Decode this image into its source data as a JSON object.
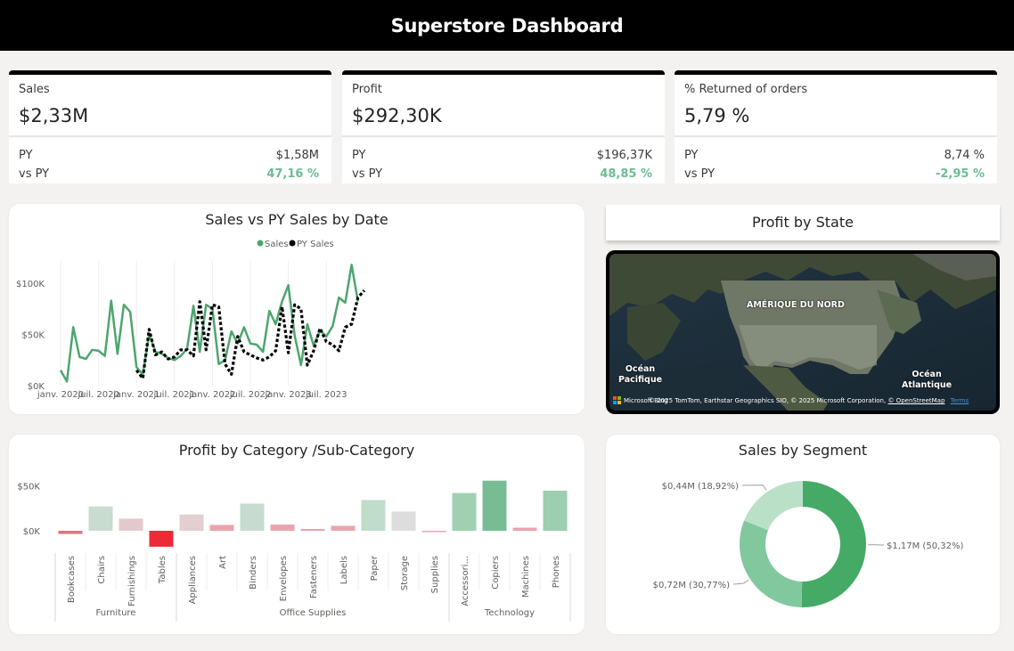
{
  "header": {
    "title": "Superstore Dashboard"
  },
  "kpis": [
    {
      "label": "Sales",
      "value": "$2,33M",
      "py_label": "PY",
      "py_value": "$1,58M",
      "vs_label": "vs PY",
      "vs_value": "47,16 %",
      "vs_color": "#6cbd91"
    },
    {
      "label": "Profit",
      "value": "$292,30K",
      "py_label": "PY",
      "py_value": "$196,37K",
      "vs_label": "vs PY",
      "vs_value": "48,85 %",
      "vs_color": "#6cbd91"
    },
    {
      "label": "% Returned of orders",
      "value": "5,79 %",
      "py_label": "PY",
      "py_value": "8,74 %",
      "vs_label": "vs PY",
      "vs_value": "-2,95 %",
      "vs_color": "#6cbd91"
    }
  ],
  "line_card": {
    "title": "Sales vs PY Sales by Date"
  },
  "map_card": {
    "title": "Profit by State",
    "label_continent": "AMÉRIQUE DU NORD",
    "label_pacific": "Océan\nPacifique",
    "label_atlantic": "Océan\nAtlantique",
    "brand": "Microsoft Bing",
    "attribution": "© 2025 TomTom, Earthstar Geographics SIO, © 2025 Microsoft Corporation,",
    "osm_link": "© OpenStreetMap",
    "terms_link": "Terms"
  },
  "bar_card": {
    "title": "Profit by Category /Sub-Category"
  },
  "donut_card": {
    "title": "Sales by Segment"
  },
  "chart_data": [
    {
      "type": "line",
      "title": "Sales vs PY Sales by Date",
      "x_ticks": [
        "janv. 2020",
        "juil. 2020",
        "janv. 2021",
        "juil. 2021",
        "janv. 2022",
        "juil. 2022",
        "janv. 2023",
        "juil. 2023"
      ],
      "y_ticks": [
        "$0K",
        "$50K",
        "$100K"
      ],
      "ylim": [
        0,
        120
      ],
      "legend": [
        "Sales",
        "PY Sales"
      ],
      "colors": {
        "Sales": "#4ea56e",
        "PY Sales": "#000000"
      },
      "series": [
        {
          "name": "Sales",
          "start_month": 0,
          "values": [
            15,
            4,
            57,
            28,
            26,
            35,
            34,
            29,
            83,
            31,
            79,
            72,
            18,
            11,
            50,
            33,
            31,
            27,
            25,
            29,
            36,
            78,
            33,
            79,
            75,
            21,
            25,
            53,
            41,
            57,
            41,
            40,
            33,
            73,
            60,
            82,
            98,
            49,
            20,
            60,
            39,
            54,
            48,
            58,
            86,
            81,
            118,
            82
          ]
        },
        {
          "name": "PY Sales",
          "start_month": 12,
          "values": [
            15,
            7,
            55,
            30,
            33,
            26,
            28,
            35,
            35,
            29,
            82,
            35,
            79,
            77,
            21,
            11,
            48,
            33,
            30,
            27,
            25,
            28,
            34,
            77,
            32,
            79,
            75,
            20,
            34,
            56,
            43,
            40,
            34,
            57,
            60,
            86,
            93
          ]
        }
      ]
    },
    {
      "type": "bar",
      "title": "Profit by Category /Sub-Category",
      "y_ticks": [
        "$50K",
        "$0K"
      ],
      "ylim": [
        -18,
        58
      ],
      "groups": [
        {
          "name": "Furniture",
          "items": [
            {
              "label": "Bookcases",
              "value": -3.5,
              "color": "#e8707f"
            },
            {
              "label": "Chairs",
              "value": 27,
              "color": "#c8dcd0"
            },
            {
              "label": "Furnishings",
              "value": 13.5,
              "color": "#e3c9cc"
            },
            {
              "label": "Tables",
              "value": -17.7,
              "color": "#ee2938"
            }
          ]
        },
        {
          "name": "Office Supplies",
          "items": [
            {
              "label": "Appliances",
              "value": 18.1,
              "color": "#e3cfd1"
            },
            {
              "label": "Art",
              "value": 6.5,
              "color": "#e9a4ae"
            },
            {
              "label": "Binders",
              "value": 30.2,
              "color": "#c8dbd0"
            },
            {
              "label": "Envelopes",
              "value": 6.9,
              "color": "#e9a4ae"
            },
            {
              "label": "Fasteners",
              "value": 2.0,
              "color": "#e9a4ae"
            },
            {
              "label": "Labels",
              "value": 5.5,
              "color": "#e9a4ae"
            },
            {
              "label": "Paper",
              "value": 34.1,
              "color": "#c0dccb"
            },
            {
              "label": "Storage",
              "value": 21.3,
              "color": "#dedddd"
            },
            {
              "label": "Supplies",
              "value": -1.2,
              "color": "#e9a4ae"
            }
          ]
        },
        {
          "name": "Technology",
          "items": [
            {
              "label": "Accessori...",
              "value": 41.9,
              "color": "#9fd0b2"
            },
            {
              "label": "Copiers",
              "value": 55.6,
              "color": "#78bc95"
            },
            {
              "label": "Machines",
              "value": 3.4,
              "color": "#e9a4ae"
            },
            {
              "label": "Phones",
              "value": 44.5,
              "color": "#9cceb0"
            }
          ]
        }
      ]
    },
    {
      "type": "pie",
      "title": "Sales by Segment",
      "slices": [
        {
          "value": 50.32,
          "label": "$1,17M (50,32%)",
          "color": "#44aa66"
        },
        {
          "value": 30.77,
          "label": "$0,72M (30,77%)",
          "color": "#82c89e"
        },
        {
          "value": 18.92,
          "label": "$0,44M (18,92%)",
          "color": "#bbe0c8"
        }
      ]
    }
  ]
}
